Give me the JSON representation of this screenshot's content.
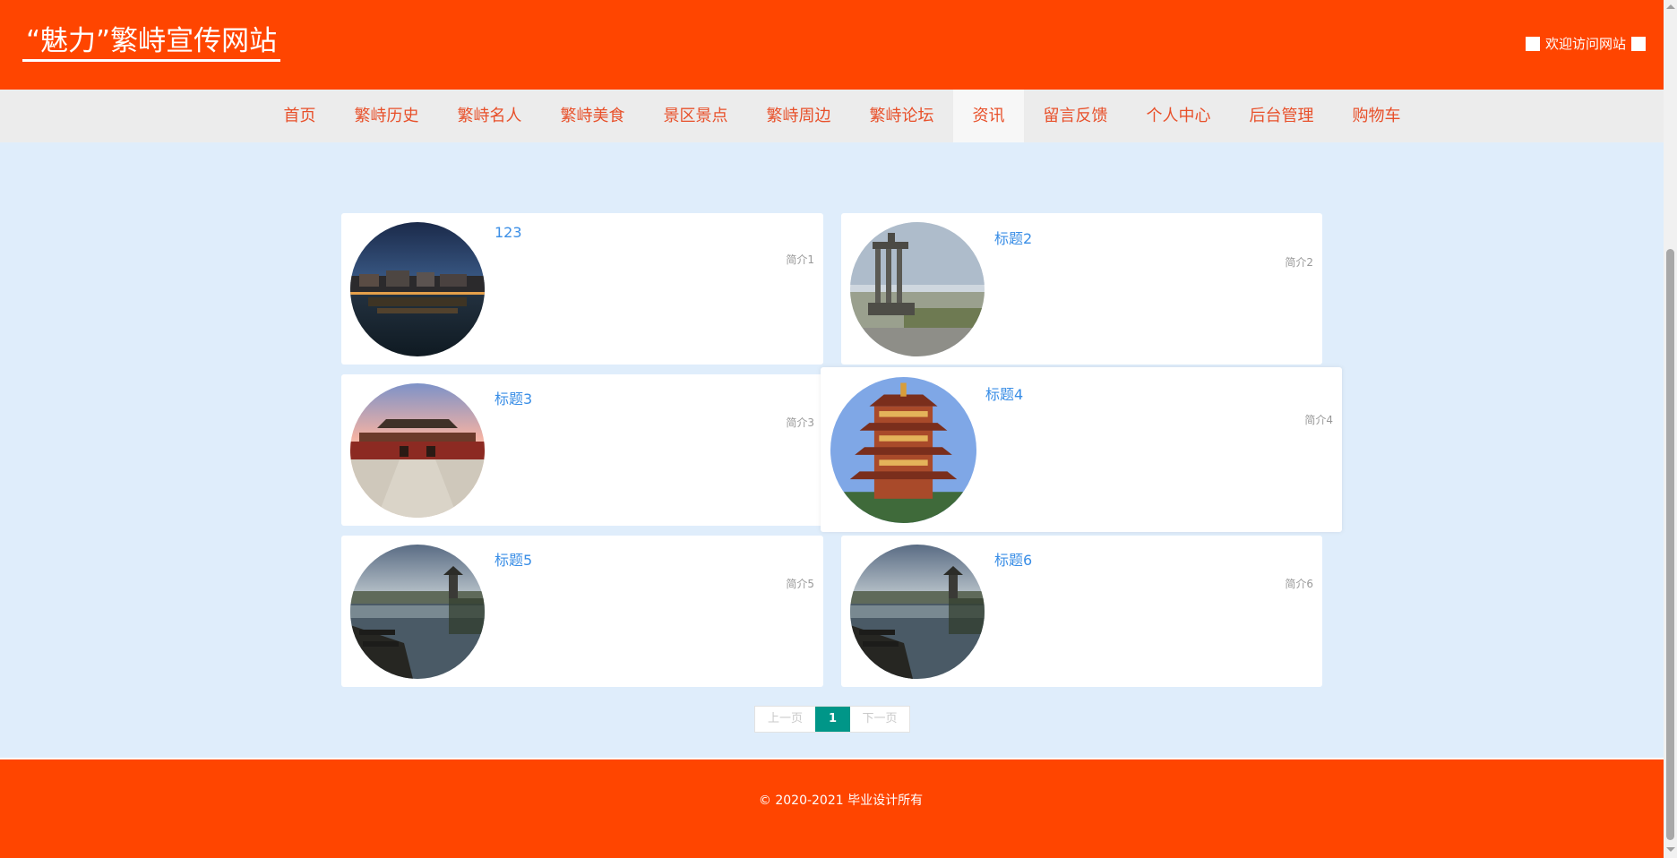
{
  "header": {
    "site_title": "“魅力”繁峙宣传网站",
    "welcome_text": "欢迎访问网站"
  },
  "nav": {
    "items": [
      {
        "label": "首页"
      },
      {
        "label": "繁峙历史"
      },
      {
        "label": "繁峙名人"
      },
      {
        "label": "繁峙美食"
      },
      {
        "label": "景区景点"
      },
      {
        "label": "繁峙周边"
      },
      {
        "label": "繁峙论坛"
      },
      {
        "label": "资讯",
        "active": true
      },
      {
        "label": "留言反馈"
      },
      {
        "label": "个人中心"
      },
      {
        "label": "后台管理"
      },
      {
        "label": "购物车"
      }
    ]
  },
  "news": {
    "items": [
      {
        "title": "123",
        "summary": "简介1",
        "image": "night-town-lake"
      },
      {
        "title": "标题2",
        "summary": "简介2",
        "image": "city-monument"
      },
      {
        "title": "标题3",
        "summary": "简介3",
        "image": "palace-gate"
      },
      {
        "title": "标题4",
        "summary": "简介4",
        "image": "yellow-crane-tower"
      },
      {
        "title": "标题5",
        "summary": "简介5",
        "image": "lakeside-village"
      },
      {
        "title": "标题6",
        "summary": "简介6",
        "image": "lakeside-village"
      }
    ]
  },
  "pagination": {
    "prev_label": "上一页",
    "current_page": "1",
    "next_label": "下一页"
  },
  "footer": {
    "copyright": "© 2020-2021 毕业设计所有"
  },
  "colors": {
    "header_bg": "#ff4500",
    "nav_text": "#e8502a",
    "link_blue": "#3a8ee6",
    "page_bg": "#dfedfb",
    "pager_active": "#009688"
  }
}
